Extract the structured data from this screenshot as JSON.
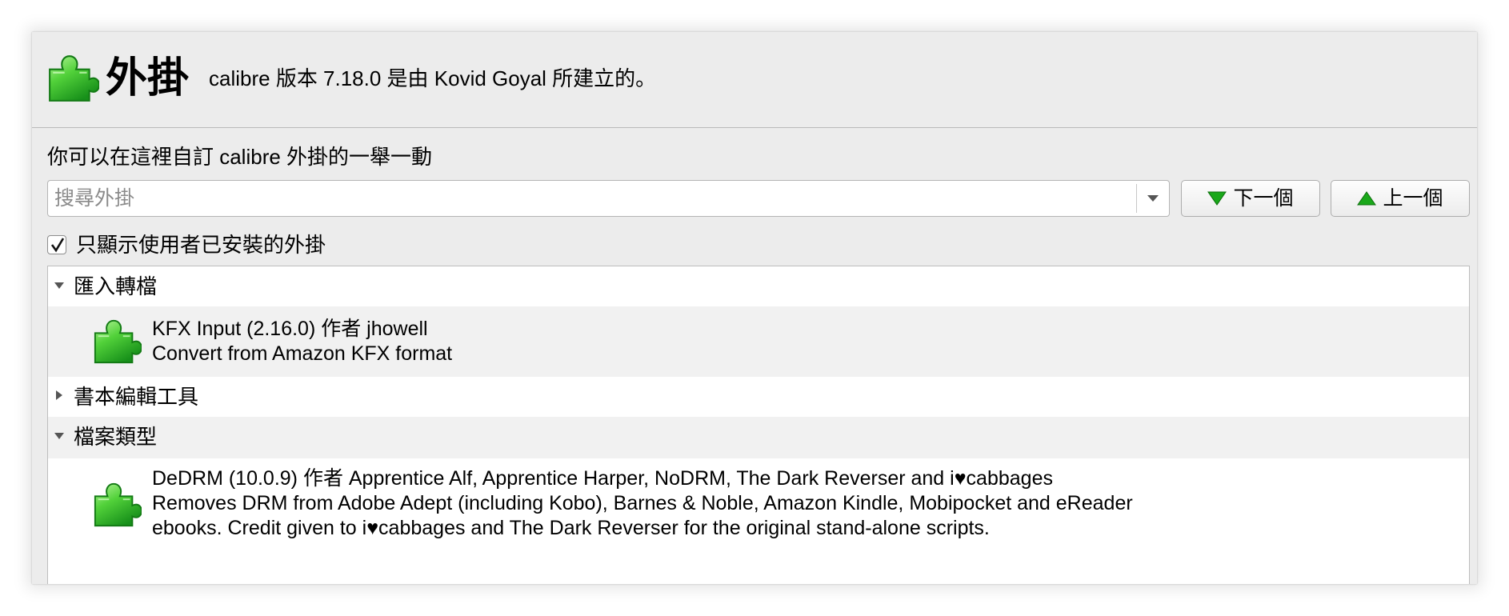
{
  "header": {
    "title": "外掛",
    "about": "calibre 版本 7.18.0 是由 Kovid Goyal 所建立的。"
  },
  "intro": "你可以在這裡自訂 calibre 外掛的一舉一動",
  "search": {
    "placeholder": "搜尋外掛",
    "value": ""
  },
  "buttons": {
    "next": "下一個",
    "prev": "上一個"
  },
  "filter": {
    "label": "只顯示使用者已安裝的外掛",
    "checked": true
  },
  "tree": {
    "categories": [
      {
        "label": "匯入轉檔",
        "expanded": true,
        "plugins": [
          {
            "name_line": "KFX Input (2.16.0) 作者 jhowell",
            "desc": [
              "Convert from Amazon KFX format"
            ]
          }
        ]
      },
      {
        "label": "書本編輯工具",
        "expanded": false,
        "plugins": []
      },
      {
        "label": "檔案類型",
        "expanded": true,
        "plugins": [
          {
            "name_line": "DeDRM (10.0.9) 作者 Apprentice Alf, Apprentice Harper, NoDRM, The Dark Reverser and i♥cabbages",
            "desc": [
              "Removes DRM from Adobe Adept (including Kobo), Barnes & Noble, Amazon Kindle, Mobipocket and eReader",
              "ebooks. Credit given to i♥cabbages and The Dark Reverser for the original stand-alone scripts."
            ]
          }
        ]
      }
    ]
  },
  "colors": {
    "puzzle_light": "#7ee35e",
    "puzzle_dark": "#1f9a1f",
    "arrow_green": "#1aa81a"
  },
  "icons": {
    "logo": "puzzle-piece-icon",
    "next": "triangle-down-icon",
    "prev": "triangle-up-icon"
  }
}
